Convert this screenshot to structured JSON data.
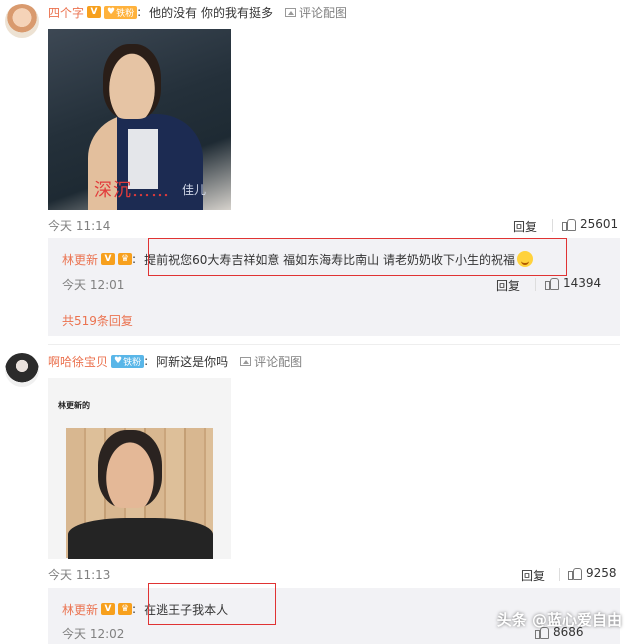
{
  "comments": [
    {
      "username": "四个字",
      "verified_badge": "V",
      "fan_badge": "铁粉",
      "text": "他的没有 你的我有挺多",
      "pic_link": "评论配图",
      "image_caption": "深沉……",
      "image_caption_tail": "佳儿",
      "time": "今天 11:14",
      "reply_label": "回复",
      "likes": "25601",
      "sub_reply": {
        "username": "林更新",
        "verified_badge": "V",
        "text": "提前祝您60大寿吉祥如意 福如东海寿比南山  请老奶奶收下小生的祝福",
        "emoji": "smiley-icon",
        "time": "今天 12:01",
        "reply_label": "回复",
        "likes": "14394"
      },
      "more_replies": "共519条回复"
    },
    {
      "username": "啊哈徐宝贝",
      "fan_badge": "铁粉",
      "text": "阿新这是你吗",
      "pic_link": "评论配图",
      "image_title": "林更新的",
      "time": "今天 11:13",
      "reply_label": "回复",
      "likes": "9258",
      "sub_reply": {
        "username": "林更新",
        "verified_badge": "V",
        "text": "在逃王子我本人",
        "time": "今天 12:02",
        "reply_label": "回复",
        "likes": "8686"
      }
    }
  ],
  "watermark": "头条 @蓝心爱自由",
  "colors": {
    "username": "#eb7350",
    "highlight_box": "#e03333",
    "sub_bg": "#f2f2f5"
  }
}
